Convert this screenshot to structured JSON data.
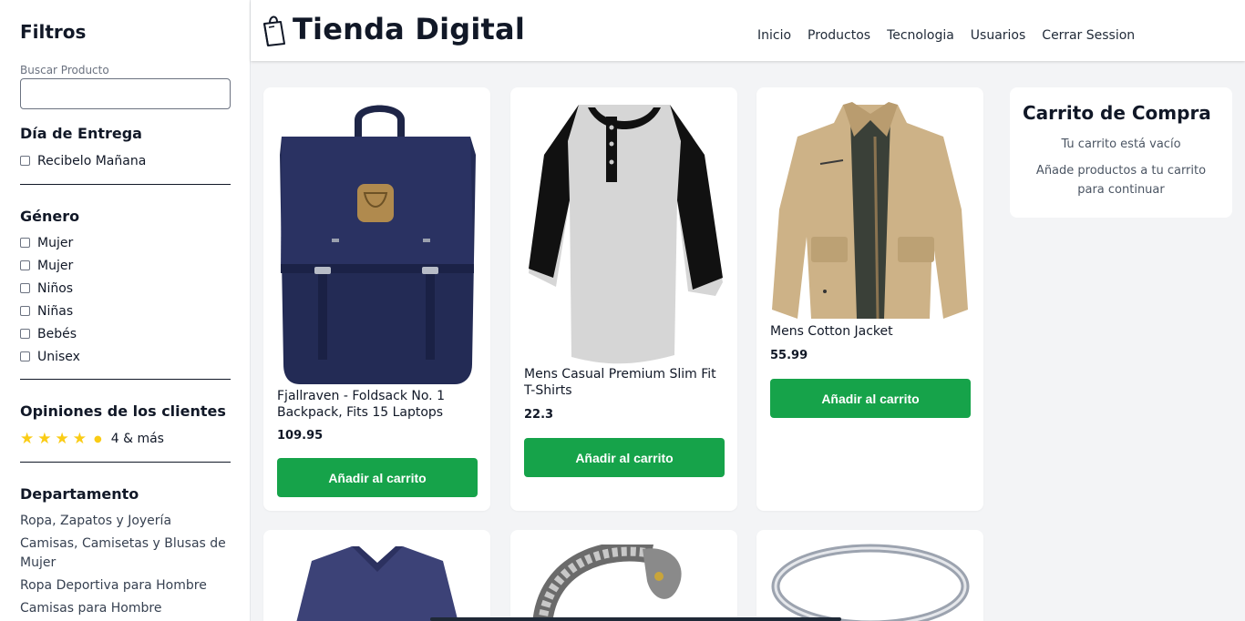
{
  "sidebar": {
    "title": "Filtros",
    "search_label": "Buscar Producto",
    "search_value": "",
    "delivery": {
      "heading": "Día de Entrega",
      "option": "Recibelo Mañana"
    },
    "gender": {
      "heading": "Género",
      "options": [
        "Mujer",
        "Mujer",
        "Niños",
        "Niñas",
        "Bebés",
        "Unisex"
      ]
    },
    "reviews": {
      "heading": "Opiniones de los clientes",
      "rating": 4,
      "label": "4 & más"
    },
    "department": {
      "heading": "Departamento",
      "links": [
        "Ropa, Zapatos y Joyería",
        "Camisas, Camisetas y Blusas de Mujer",
        "Ropa Deportiva para Hombre",
        "Camisas para Hombre"
      ]
    }
  },
  "header": {
    "brand": "Tienda Digital",
    "nav": [
      "Inicio",
      "Productos",
      "Tecnologia",
      "Usuarios",
      "Cerrar Session"
    ]
  },
  "products": [
    {
      "name": "Fjallraven - Foldsack No. 1 Backpack, Fits 15 Laptops",
      "price": "109.95",
      "button": "Añadir al carrito",
      "icon": "backpack-image"
    },
    {
      "name": "Mens Casual Premium Slim Fit T-Shirts",
      "price": "22.3",
      "button": "Añadir al carrito",
      "icon": "tshirt-image"
    },
    {
      "name": "Mens Cotton Jacket",
      "price": "55.99",
      "button": "Añadir al carrito",
      "icon": "jacket-image"
    }
  ],
  "cart": {
    "title": "Carrito de Compra",
    "empty": "Tu carrito está vacío",
    "hint": "Añade productos a tu carrito para continuar"
  },
  "colors": {
    "accent": "#16a34a",
    "star": "#facc15"
  }
}
